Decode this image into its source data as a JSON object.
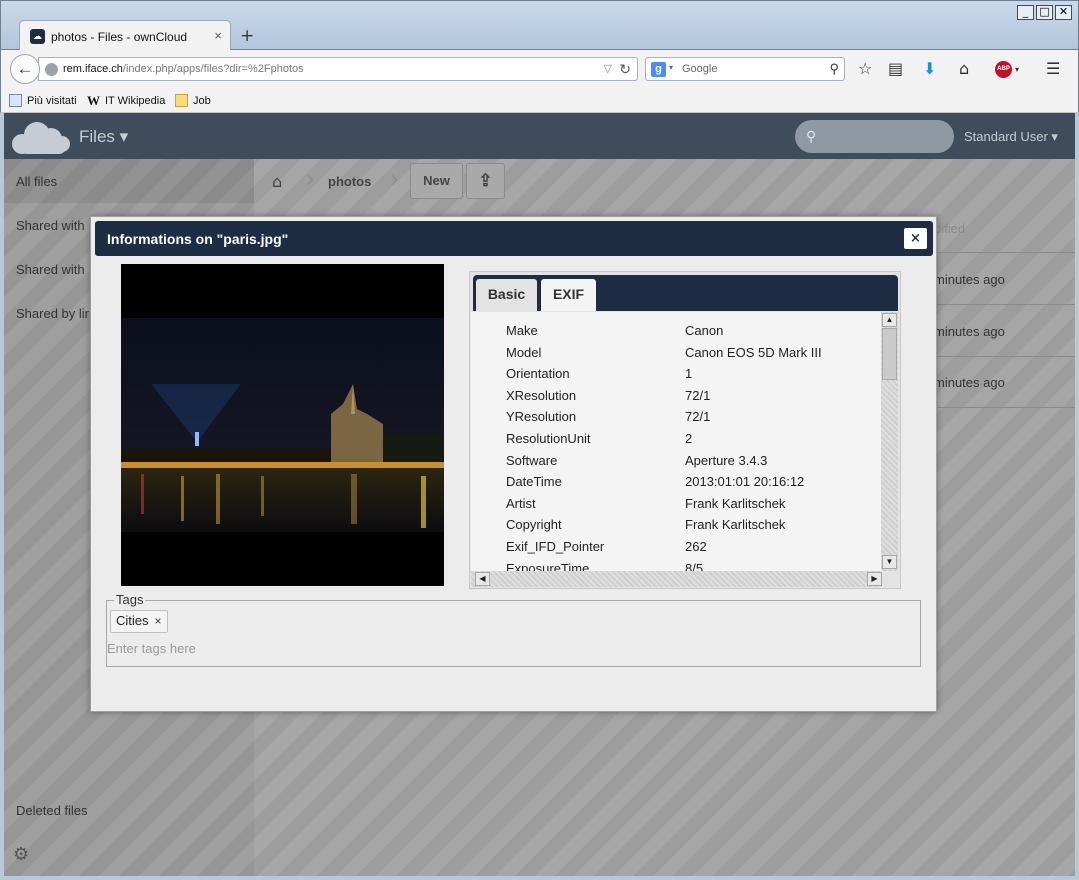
{
  "browser": {
    "tab_title": "photos - Files - ownCloud",
    "tab_close": "×",
    "new_tab": "+",
    "url_host": "rem.iface.ch",
    "url_path": "/index.php/apps/files?dir=%2Fphotos",
    "search_engine_letter": "g",
    "search_placeholder": "Google",
    "adblock_label": "ABP",
    "bookmarks": [
      "Più visitati",
      "IT Wikipedia",
      "Job"
    ],
    "window_buttons": [
      "_",
      "□",
      "✕"
    ]
  },
  "owncloud": {
    "app_name": "Files ▾",
    "user_name": "Standard User ▾",
    "sidebar": {
      "items": [
        "All files",
        "Shared with",
        "Shared with",
        "Shared by lir"
      ],
      "deleted": "Deleted files"
    },
    "breadcrumb": {
      "folder": "photos"
    },
    "actions": {
      "new_label": "New"
    },
    "table": {
      "modified_header": "dified",
      "rows": [
        "minutes ago",
        "minutes ago",
        "minutes ago"
      ]
    }
  },
  "dialog": {
    "title": "Informations on \"paris.jpg\"",
    "close_label": "×",
    "tabs": [
      "Basic",
      "EXIF"
    ],
    "active_tab": "EXIF",
    "exif": [
      {
        "key": "Make",
        "value": "Canon"
      },
      {
        "key": "Model",
        "value": "Canon EOS 5D Mark III"
      },
      {
        "key": "Orientation",
        "value": "1"
      },
      {
        "key": "XResolution",
        "value": "72/1"
      },
      {
        "key": "YResolution",
        "value": "72/1"
      },
      {
        "key": "ResolutionUnit",
        "value": "2"
      },
      {
        "key": "Software",
        "value": "Aperture 3.4.3"
      },
      {
        "key": "DateTime",
        "value": "2013:01:01 20:16:12"
      },
      {
        "key": "Artist",
        "value": "Frank Karlitschek"
      },
      {
        "key": "Copyright",
        "value": "Frank Karlitschek"
      },
      {
        "key": "Exif_IFD_Pointer",
        "value": "262"
      },
      {
        "key": "ExposureTime",
        "value": "8/5"
      }
    ],
    "tags": {
      "legend": "Tags",
      "items": [
        "Cities"
      ],
      "remove_label": "×",
      "placeholder": "Enter tags here"
    }
  },
  "colors": {
    "owncloud_dark": "#1d2d44",
    "header_bg": "#3e4c5b"
  }
}
